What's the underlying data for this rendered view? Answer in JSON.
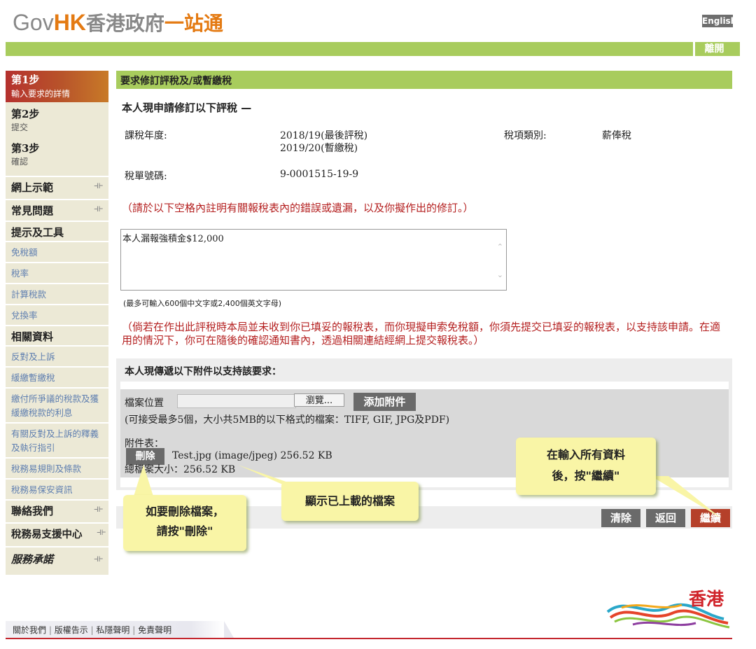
{
  "header": {
    "logo_gov": "Gov",
    "logo_hk": "HK",
    "logo_zh1": "香港政府",
    "logo_zh2": "一站通",
    "english_label": "English",
    "logout_label": "離開"
  },
  "sidebar": {
    "steps": [
      {
        "title": "第1步",
        "sub": "輸入要求的詳情"
      },
      {
        "title": "第2步",
        "sub": "提交"
      },
      {
        "title": "第3步",
        "sub": "確認"
      }
    ],
    "menu_demo": "網上示範",
    "menu_faq": "常見問題",
    "menu_tips": "提示及工具",
    "tips_links": [
      "免稅額",
      "稅率",
      "計算稅款",
      "兌換率"
    ],
    "menu_related": "相關資料",
    "related_links": [
      "反對及上訴",
      "緩繳暫繳稅",
      "繳付所爭議的稅款及獲緩繳稅款的利息",
      "有關反對及上訴的釋義及執行指引",
      "稅務易規則及條款",
      "稅務易保安資訊"
    ],
    "menu_contact": "聯絡我們",
    "menu_support": "稅務易支援中心",
    "menu_promise": "服務承諾"
  },
  "main": {
    "title": "要求修訂評稅及/或暫繳稅",
    "intro": "本人現申請修訂以下評稅 —",
    "year_label": "課稅年度:",
    "year_value1": "2018/19(最後評稅)",
    "year_value2": "2019/20(暫繳稅)",
    "tax_type_label": "稅項類別:",
    "tax_type_value": "薪俸稅",
    "notice_label": "稅單號碼:",
    "notice_value": "9-0001515-19-9",
    "instruction": "（請於以下空格內註明有關報稅表內的錯誤或遺漏，以及你擬作出的修訂。）",
    "textarea_value": "本人漏報強積金$12,000",
    "textarea_note": "(最多可輸入600個中文字或2,400個英文字母)",
    "warning": "（倘若在作出此評稅時本局並未收到你已填妥的報稅表，而你現擬申索免稅額，你須先提交已填妥的報稅表，以支持該申請。在適用的情況下，你可在隨後的確認通知書內，透過相關連結經網上提交報稅表。）",
    "attach_heading": "本人現傳遞以下附件以支持該要求：",
    "file_location_label": "檔案位置",
    "browse_label": "瀏覽...",
    "add_attachment_label": "添加附件",
    "file_hint": "(可接受最多5個，大小共5MB的以下格式的檔案：TIFF, GIF, JPG及PDF)",
    "attachment_list_label": "附件表：",
    "delete_label": "刪除",
    "attachment_file": "Test.jpg (image/jpeg) 256.52 KB",
    "total_size": "總檔案大小：256.52 KB",
    "clear_label": "清除",
    "back_label": "返回",
    "continue_label": "繼續"
  },
  "callouts": {
    "delete_tip_line1": "如要刪除檔案，",
    "delete_tip_line2": "請按\"刪除\"",
    "uploaded_tip": "顯示已上載的檔案",
    "continue_tip_line1": "在輸入所有資料",
    "continue_tip_line2": "後，按\"繼續\""
  },
  "footer": {
    "links": [
      "關於我們",
      "版權告示",
      "私隱聲明",
      "免責聲明"
    ],
    "brand_logo": "香港"
  },
  "colors": {
    "green": "#a8cc5d",
    "orange": "#e47a12",
    "red_text": "#b41f1f",
    "continue_button": "#b5402a",
    "callout": "#f9f5a6"
  }
}
